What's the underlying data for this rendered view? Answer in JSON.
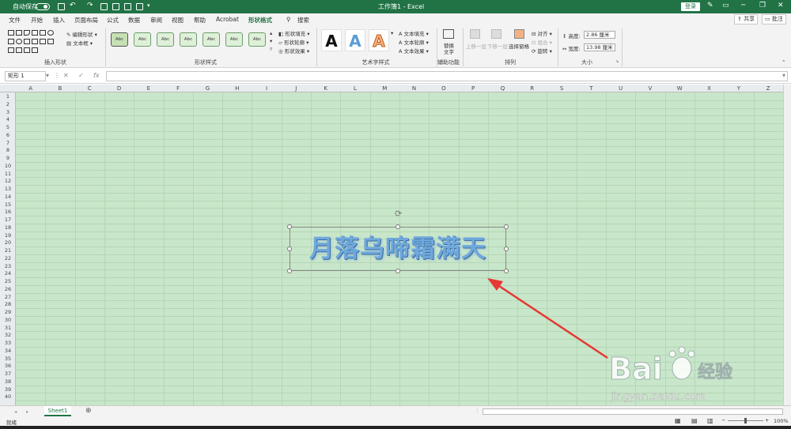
{
  "titlebar": {
    "autosave": "自动保存",
    "title": "工作簿1 - Excel",
    "login": "登录"
  },
  "menu": [
    "文件",
    "开始",
    "插入",
    "页面布局",
    "公式",
    "数据",
    "审阅",
    "视图",
    "帮助",
    "Acrobat",
    "形状格式"
  ],
  "search": "搜索",
  "share": "共享",
  "comment": "批注",
  "ribbon": {
    "insert_shapes": {
      "label": "插入形状",
      "edit_shape": "编辑形状",
      "text_box": "文本框"
    },
    "shape_styles": {
      "label": "形状样式",
      "swatch_text": "Abc",
      "fill": "形状填充",
      "outline": "形状轮廓",
      "effect": "形状效果"
    },
    "wordart": {
      "label": "艺术字样式",
      "letter": "A",
      "text_fill": "文本填充",
      "text_outline": "文本轮廓",
      "text_effect": "文本效果"
    },
    "accessibility": {
      "label": "辅助功能",
      "alt_text_line1": "替换",
      "alt_text_line2": "文字"
    },
    "arrange": {
      "label": "排列",
      "bring_forward": "上移一层",
      "send_backward": "下移一层",
      "selection_pane": "选择窗格",
      "align": "对齐",
      "group": "组合",
      "rotate": "旋转"
    },
    "size": {
      "label": "大小",
      "height_label": "高度:",
      "height_value": "2.86 厘米",
      "width_label": "宽度:",
      "width_value": "13.98 厘米"
    }
  },
  "formula_bar": {
    "name_box": "矩形 1",
    "fx": "fx",
    "cancel": "✕",
    "confirm": "✓"
  },
  "columns": [
    "A",
    "B",
    "C",
    "D",
    "E",
    "F",
    "G",
    "H",
    "I",
    "J",
    "K",
    "L",
    "M",
    "N",
    "O",
    "P",
    "Q",
    "R",
    "S",
    "T",
    "U",
    "V",
    "W",
    "X",
    "Y",
    "Z"
  ],
  "rows": [
    "1",
    "2",
    "3",
    "4",
    "5",
    "6",
    "7",
    "8",
    "9",
    "10",
    "11",
    "12",
    "13",
    "14",
    "15",
    "16",
    "17",
    "18",
    "19",
    "20",
    "21",
    "22",
    "23",
    "24",
    "25",
    "26",
    "27",
    "28",
    "29",
    "30",
    "31",
    "32",
    "33",
    "34",
    "35",
    "36",
    "37",
    "38",
    "39",
    "40"
  ],
  "shape_text": "月落乌啼霜满天",
  "sheet_tab": "Sheet1",
  "status": {
    "ready": "就绪",
    "zoom": "100%"
  },
  "watermark": {
    "line1": "Bai",
    "line2": "经验",
    "url": "jingyan.baidu.com"
  }
}
